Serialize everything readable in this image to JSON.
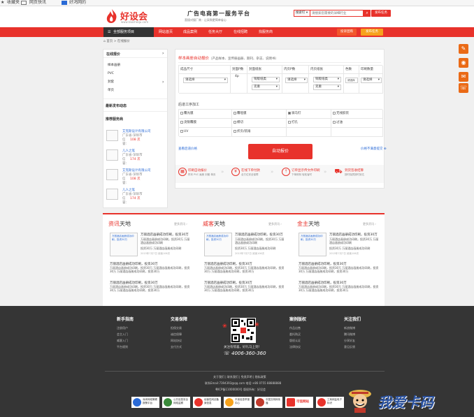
{
  "browser": {
    "tab1": "收藏夹",
    "tab2": "网页快讯",
    "tab3": "好鸿网的"
  },
  "header": {
    "logo_text": "好设会",
    "logo_url": "www.taoshequ.com",
    "slogan": "广告电商第一服务平台",
    "sub_slogan": "直接对接厂商 · 让采购更简单省心",
    "search_select": "搜索钉 ▾",
    "search_placeholder": "请搜索您需要的详细行业",
    "search_button": "发布任务"
  },
  "nav": {
    "all": "全部服务项目",
    "items": [
      "网站首页",
      "成品案例",
      "任务大厅",
      "在线招聘",
      "找服务商"
    ],
    "btn1": "投诉团购",
    "btn2": "发布任务"
  },
  "breadcrumb": "首页 > 在线报价",
  "sidebar": {
    "quote_title": "在线报价",
    "quote_items": [
      "样本画册",
      "PVC",
      "封套",
      "单页"
    ],
    "news_title": "最新发布动态",
    "rec_title": "推荐服务商",
    "providers": [
      {
        "name": "艾克斯设计有限公司",
        "loc": "广东省-深圳市",
        "rating": "信誉：",
        "num": "108 次"
      },
      {
        "name": "儿人之笔",
        "loc": "广东省-深圳市",
        "rating": "信誉：",
        "num": "174 次"
      },
      {
        "name": "艾克斯设计有限公司",
        "loc": "广东省-深圳市",
        "rating": "信誉：",
        "num": "108 次"
      },
      {
        "name": "儿人之笔",
        "loc": "广东省-深圳市",
        "rating": "信誉：",
        "num": "174 次"
      }
    ]
  },
  "quote": {
    "title": "样本画册自动报价",
    "subtitle": "（产品样本、宣传册画册、期刊、杂志、说明书）",
    "headers": [
      "成品尺寸",
      "封面P数",
      "封面纸张",
      "内页P数",
      "内页纸张",
      "色数",
      "印刷数量"
    ],
    "select_default": "请选择",
    "size_option": "请选择",
    "cover_p": "4p",
    "cover_paper": "铜版纸类",
    "cover_weight": "克重",
    "inner_paper": "铜版纸类",
    "inner_weight": "克重",
    "color_default": "请选择",
    "qty_default": "请选择",
    "post_title": "后道工序加工",
    "post_options": [
      [
        "覆光膜",
        "覆哑膜",
        "骑马钉",
        "无线胶装"
      ],
      [
        "烫银覆膜",
        "模切",
        "打孔",
        "过油"
      ],
      [
        "UV",
        "折页/装裱",
        "",
        ""
      ]
    ],
    "left_link": "查看后道价格",
    "btn": "自动报价",
    "right_link": "价格不满意提交 ⊕"
  },
  "steps": [
    {
      "title": "印刷自动报价",
      "desc": "样本 PVC 画册 封套 单页"
    },
    {
      "title": "在线下单付款",
      "desc": "全方位安全保障"
    },
    {
      "title": "订单显示传文件印刷",
      "desc": "下单即刻 轻松省时"
    },
    {
      "title": "到货签收结算",
      "desc": "按时保质按时到达"
    }
  ],
  "news_cards": [
    {
      "title_a": "资讯",
      "title_b": "天地",
      "more": "更多资讯 ›",
      "img_caption": "万丽酒店画册成功印刷，投资30万",
      "headline": "万丽酒店画册成功印刷，投资30万",
      "lines": [
        "万丽酒店画册成功印刷，投资30万 万丽酒店画册成功印刷",
        "投资30万 万丽酒店画册成功印刷"
      ],
      "meta": "2015年7月7日 阅读106次",
      "list": [
        {
          "h": "万丽酒店画册成功印刷，投资30万",
          "t": "万丽酒店画册成功印刷，投资30万 万丽酒店画册成功印刷，投资30万 万丽酒店画册成功印刷，投资30万"
        },
        {
          "h": "万丽酒店画册成功印刷，投资30万",
          "t": "万丽酒店画册成功印刷，投资30万 万丽酒店画册成功印刷，投资30万 万丽酒店画册成功印刷，投资30万"
        }
      ]
    },
    {
      "title_a": "威客",
      "title_b": "天地",
      "more": "更多资讯 ›",
      "img_caption": "万丽酒店画册成功印刷，投资30万",
      "headline": "万丽酒店画册成功印刷，投资30万",
      "lines": [
        "万丽酒店画册成功印刷，投资30万 万丽酒店画册成功印刷",
        "投资30万 万丽酒店画册成功印刷"
      ],
      "meta": "2015年7月7日 阅读106次",
      "list": [
        {
          "h": "万丽酒店画册成功印刷，投资30万",
          "t": "万丽酒店画册成功印刷，投资30万 万丽酒店画册成功印刷，投资30万 万丽酒店画册成功印刷，投资30万"
        },
        {
          "h": "万丽酒店画册成功印刷，投资30万",
          "t": "万丽酒店画册成功印刷，投资30万 万丽酒店画册成功印刷，投资30万 万丽酒店画册成功印刷，投资30万"
        }
      ]
    },
    {
      "title_a": "金主",
      "title_b": "天地",
      "more": "更多资讯 ›",
      "img_caption": "万丽酒店画册成功印刷，投资30万",
      "headline": "万丽酒店画册成功印刷，投资30万",
      "lines": [
        "万丽酒店画册成功印刷，投资30万 万丽酒店画册成功印刷",
        "投资30万 万丽酒店画册成功印刷"
      ],
      "meta": "2015年7月7日 阅读106次",
      "list": [
        {
          "h": "万丽酒店画册成功印刷，投资30万",
          "t": "万丽酒店画册成功印刷，投资30万 万丽酒店画册成功印刷，投资30万 万丽酒店画册成功印刷，投资30万"
        },
        {
          "h": "万丽酒店画册成功印刷，投资30万",
          "t": "万丽酒店画册成功印刷，投资30万 万丽酒店画册成功印刷，投资30万 万丽酒店画册成功印刷，投资30万"
        }
      ]
    }
  ],
  "footer": {
    "cols": [
      {
        "title": "新手指南",
        "items": [
          "注册用户",
          "会主入门",
          "威客入门",
          "平台规则"
        ]
      },
      {
        "title": "交易保障",
        "items": [
          "担保交易",
          "诚信保障",
          "网站协议",
          "支付方式"
        ]
      },
      {
        "title": "案例版权",
        "items": [
          "作品出售",
          "委托购买",
          "版权认证",
          "法律协议"
        ]
      },
      {
        "title": "关注我们",
        "items": [
          "新浪微博",
          "腾讯微博",
          "分享好友",
          "意见反馈"
        ]
      }
    ],
    "qr_caption": "关注有惊喜，好礼马上到！",
    "phone": "4006-360-360",
    "links": "关于我们 | 联系我们 | 免责声明 | 隐私政策",
    "contact": "联系Email:7394393@qq.com 电话:+86 0755 88888888",
    "icp": "粤ICP备11000000号  版权所有：好设会",
    "badges": [
      "深圳网络警察报警平台",
      "公共信息安全网络监察",
      "经营性网站备案信息",
      "不良信息举报中心",
      "中国文明网传播",
      "可信网站",
      "工商网监电子标识"
    ],
    "watermark": "我爱卡码"
  }
}
